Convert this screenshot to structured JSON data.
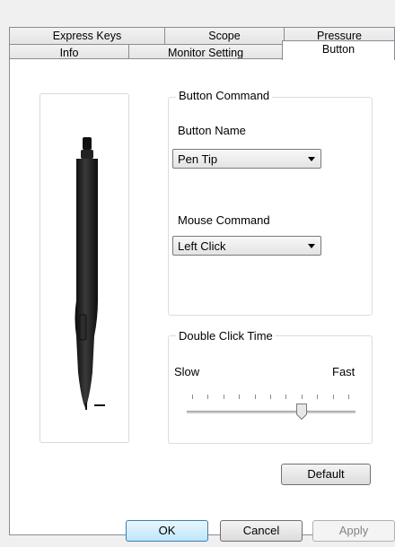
{
  "tabs_row_back": [
    {
      "label": "Express Keys"
    },
    {
      "label": "Scope"
    },
    {
      "label": "Pressure"
    }
  ],
  "tabs_row_front": [
    {
      "label": "Info"
    },
    {
      "label": "Monitor Setting"
    },
    {
      "label": "Button"
    }
  ],
  "button_command": {
    "group_title": "Button Command",
    "button_name_label": "Button Name",
    "button_name_value": "Pen Tip",
    "mouse_command_label": "Mouse Command",
    "mouse_command_value": "Left Click"
  },
  "double_click": {
    "group_title": "Double Click Time",
    "slow_label": "Slow",
    "fast_label": "Fast",
    "tick_count": 11,
    "position_index": 7
  },
  "buttons": {
    "default": "Default",
    "ok": "OK",
    "cancel": "Cancel",
    "apply": "Apply"
  },
  "colors": {
    "accent": "#3c7fb1",
    "pen": "#1f1f1f"
  }
}
